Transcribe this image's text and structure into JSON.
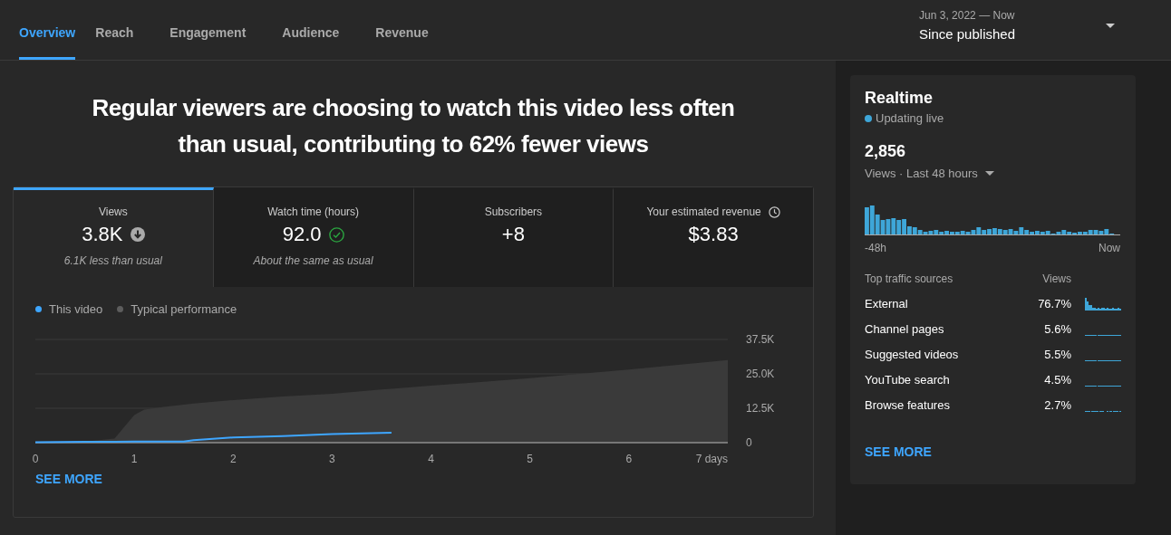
{
  "tabs": [
    {
      "label": "Overview",
      "selected": true
    },
    {
      "label": "Reach",
      "selected": false
    },
    {
      "label": "Engagement",
      "selected": false
    },
    {
      "label": "Audience",
      "selected": false
    },
    {
      "label": "Revenue",
      "selected": false
    }
  ],
  "date_range": {
    "range": "Jun 3, 2022 — Now",
    "label": "Since published"
  },
  "headline": "Regular viewers are choosing to watch this video less often than usual, contributing to 62% fewer views",
  "metrics": [
    {
      "label": "Views",
      "value": "3.8K",
      "kind": "below_usual",
      "note": "6.1K less than usual",
      "selected": true
    },
    {
      "label": "Watch time (hours)",
      "value": "92.0",
      "kind": "usual",
      "note": "About the same as usual",
      "selected": false
    },
    {
      "label": "Subscribers",
      "value": "+8",
      "kind": "plain",
      "selected": false
    },
    {
      "label": "Your estimated revenue",
      "value": "$3.83",
      "kind": "estimated",
      "selected": false
    }
  ],
  "chart_data": {
    "type": "line",
    "x": [
      0,
      0.5,
      0.8,
      1,
      1.1,
      1.3,
      1.5,
      1.6,
      2,
      2.5,
      3,
      3.5,
      3.6,
      4,
      5,
      6,
      7
    ],
    "series": [
      {
        "name": "This video",
        "color": "#3ea6ff",
        "values": [
          0.2,
          0.3,
          0.3,
          0.4,
          0.4,
          0.4,
          0.4,
          0.9,
          1.9,
          2.4,
          3.1,
          3.5,
          3.6,
          null,
          null,
          null,
          null
        ]
      },
      {
        "name": "Typical performance",
        "type": "area",
        "color": "#3a3a3a",
        "values": [
          0.2,
          0.4,
          1.5,
          10,
          12,
          13,
          13.8,
          14.2,
          15.5,
          16.8,
          17.8,
          19.3,
          19.6,
          20.7,
          23.4,
          26.6,
          30
        ]
      }
    ],
    "xlim": [
      0,
      7
    ],
    "ylim": [
      0,
      37.5
    ],
    "xticks": [
      {
        "value": 0,
        "label": "0"
      },
      {
        "value": 1,
        "label": "1"
      },
      {
        "value": 2,
        "label": "2"
      },
      {
        "value": 3,
        "label": "3"
      },
      {
        "value": 4,
        "label": "4"
      },
      {
        "value": 5,
        "label": "5"
      },
      {
        "value": 6,
        "label": "6"
      },
      {
        "value": 7,
        "label": "7 days"
      }
    ],
    "yticks": [
      {
        "value": 0,
        "label": "0"
      },
      {
        "value": 12.5,
        "label": "12.5K"
      },
      {
        "value": 25,
        "label": "25.0K"
      },
      {
        "value": 37.5,
        "label": "37.5K"
      }
    ]
  },
  "see_more": "SEE MORE",
  "realtime": {
    "title": "Realtime",
    "status": "Updating live",
    "count": "2,856",
    "period": "Views · Last 48 hours",
    "axis_start": "-48h",
    "axis_end": "Now",
    "sources_heading": "Top traffic sources",
    "views_heading": "Views",
    "sources": [
      {
        "name": "External",
        "share": "76.7%",
        "kind": "spiky"
      },
      {
        "name": "Channel pages",
        "share": "5.6%",
        "kind": "flat"
      },
      {
        "name": "Suggested videos",
        "share": "5.5%",
        "kind": "flat"
      },
      {
        "name": "YouTube search",
        "share": "4.5%",
        "kind": "flat"
      },
      {
        "name": "Browse features",
        "share": "2.7%",
        "kind": "dashed"
      }
    ],
    "see_more": "SEE MORE"
  }
}
